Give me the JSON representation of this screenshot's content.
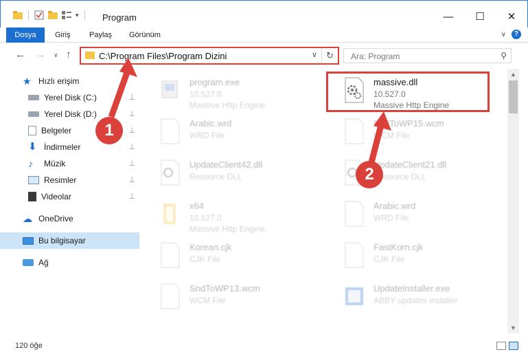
{
  "window": {
    "title": "Program",
    "minimize_label": "—",
    "maximize_label": "☐",
    "close_label": "✕"
  },
  "ribbon": {
    "tabs": [
      "Dosya",
      "Giriş",
      "Paylaş",
      "Görünüm"
    ],
    "expand_label": "∨",
    "help_label": "?"
  },
  "address": {
    "path": "C:\\Program Files\\Program Dizini",
    "dropdown_label": "∨",
    "refresh_label": "↻"
  },
  "search": {
    "placeholder": "Ara: Program"
  },
  "sidebar": {
    "items": [
      {
        "label": "Hızlı erişim",
        "icon": "star-icon"
      },
      {
        "label": "Yerel Disk (C:)",
        "icon": "drive-icon",
        "pinned": true
      },
      {
        "label": "Yerel Disk (D:)",
        "icon": "drive-icon",
        "pinned": true
      },
      {
        "label": "Belgeler",
        "icon": "documents-icon",
        "pinned": true
      },
      {
        "label": "İndirmeler",
        "icon": "downloads-icon",
        "pinned": true
      },
      {
        "label": "Müzik",
        "icon": "music-icon",
        "pinned": true
      },
      {
        "label": "Resimler",
        "icon": "pictures-icon",
        "pinned": true
      },
      {
        "label": "Videolar",
        "icon": "videos-icon",
        "pinned": true
      },
      {
        "label": "OneDrive",
        "icon": "cloud-icon"
      },
      {
        "label": "Bu bilgisayar",
        "icon": "computer-icon",
        "selected": true
      },
      {
        "label": "Ağ",
        "icon": "network-icon"
      }
    ],
    "pin_glyph": "📌"
  },
  "files": [
    {
      "name": "program.exe",
      "line1": "10.527.0",
      "line2": "Massive Http Engine",
      "faded": true
    },
    {
      "name": "massive.dll",
      "line1": "10.527.0",
      "line2": "Massive Http Engine",
      "faded": false
    },
    {
      "name": "Arabic.wrd",
      "line1": "WRD File",
      "line2": "",
      "faded": true
    },
    {
      "name": "SndToWP15.wcm",
      "line1": "WCM File",
      "line2": "",
      "faded": true
    },
    {
      "name": "UpdateClient42.dll",
      "line1": "Resource DLL",
      "line2": "",
      "faded": true
    },
    {
      "name": "UpdateClient21.dll",
      "line1": "Resource DLL",
      "line2": "",
      "faded": true
    },
    {
      "name": "x64",
      "line1": "10.527.0",
      "line2": "Massive Http Engine",
      "faded": true
    },
    {
      "name": "Arabic.wrd",
      "line1": "WRD File",
      "line2": "",
      "faded": true
    },
    {
      "name": "Korean.cjk",
      "line1": "CJK File",
      "line2": "",
      "faded": true
    },
    {
      "name": "FastKorn.cjk",
      "line1": "CJK File",
      "line2": "",
      "faded": true
    },
    {
      "name": "SndToWP13.wcm",
      "line1": "WCM File",
      "line2": "",
      "faded": true
    },
    {
      "name": "UpdateInstaller.exe",
      "line1": "ABBY updates installer",
      "line2": "",
      "faded": true
    }
  ],
  "status": {
    "count": "120 öğe"
  },
  "markers": [
    "1",
    "2"
  ],
  "colors": {
    "accent": "#1b6fd0",
    "highlight": "#d9413a",
    "selected_bg": "#cce4f7",
    "folder": "#f3c649"
  }
}
